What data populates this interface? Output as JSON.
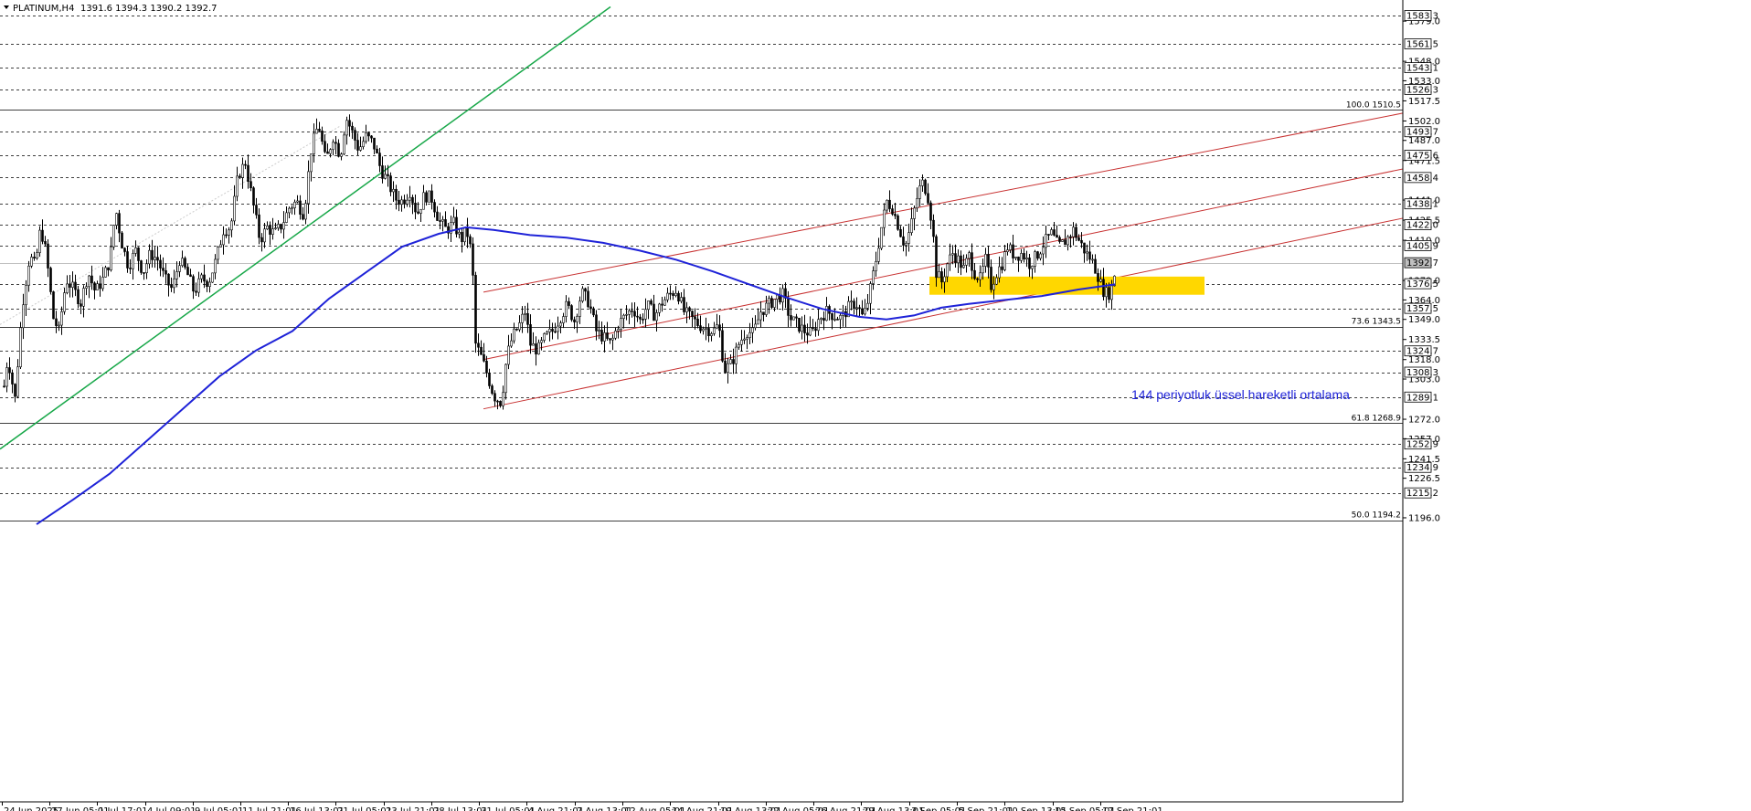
{
  "header": {
    "symbol": "PLATINUM,H4",
    "ohlc": "1391.6 1394.3 1390.2 1392.7"
  },
  "chart_data": {
    "type": "candlestick",
    "ylim": [
      1189.0,
      1592.0
    ],
    "grid": false,
    "price_ticks": [
      "1579.0",
      "1548.0",
      "1533.0",
      "1517.5",
      "1502.0",
      "1487.0",
      "1471.5",
      "1441.0",
      "1425.5",
      "1410.0",
      "1379.0",
      "1364.0",
      "1349.0",
      "1333.5",
      "1318.0",
      "1303.0",
      "1272.0",
      "1257.0",
      "1241.5",
      "1226.5",
      "1196.0"
    ],
    "level_labels": [
      "1583.3",
      "1561.5",
      "1543.1",
      "1526.3",
      "1493.7",
      "1475.6",
      "1458.4",
      "1438.1",
      "1422.0",
      "1405.9",
      "1376.5",
      "1357.5",
      "1324.7",
      "1308.3",
      "1289.1",
      "1252.9",
      "1234.9",
      "1215.2"
    ],
    "current_price": "1392.7",
    "x_labels": [
      "24 Jun 2025",
      "27 Jun 05:01",
      "1 Jul 17:01",
      "4 Jul 09:01",
      "9 Jul 05:01",
      "11 Jul 21:01",
      "16 Jul 13:01",
      "21 Jul 05:01",
      "23 Jul 21:01",
      "28 Jul 13:01",
      "31 Jul 05:01",
      "4 Aug 21:01",
      "7 Aug 13:01",
      "12 Aug 05:01",
      "14 Aug 21:01",
      "19 Aug 13:01",
      "22 Aug 05:01",
      "26 Aug 21:01",
      "29 Aug 13:01",
      "3 Sep 05:01",
      "5 Sep 21:01",
      "10 Sep 13:01",
      "15 Sep 05:01",
      "17 Sep 21:01"
    ],
    "fib_labels": [
      {
        "text": "100.0 1510.5",
        "value": 1510.5
      },
      {
        "text": "73.6 1343.5",
        "value": 1343.5
      },
      {
        "text": "61.8 1268.9",
        "value": 1268.9
      },
      {
        "text": "50.0 1194.2",
        "value": 1194.2
      }
    ],
    "annotation": "144 periyotluk üssel hareketli ortalama",
    "colors": {
      "ema": "#1f23d8",
      "channel": "#c83232",
      "trendline": "#19a84a",
      "zone": "#ffd700",
      "candle": "#000000",
      "annotation": "#1f23d8"
    },
    "support_zone": [
      1368.0,
      1382.0
    ],
    "price_path": [
      [
        0,
        1275
      ],
      [
        8,
        1320
      ],
      [
        16,
        1288
      ],
      [
        24,
        1360
      ],
      [
        32,
        1398
      ],
      [
        38,
        1390
      ],
      [
        44,
        1420
      ],
      [
        50,
        1400
      ],
      [
        58,
        1350
      ],
      [
        64,
        1340
      ],
      [
        72,
        1380
      ],
      [
        80,
        1372
      ],
      [
        88,
        1362
      ],
      [
        96,
        1385
      ],
      [
        104,
        1370
      ],
      [
        112,
        1380
      ],
      [
        120,
        1395
      ],
      [
        126,
        1435
      ],
      [
        132,
        1410
      ],
      [
        140,
        1390
      ],
      [
        148,
        1402
      ],
      [
        156,
        1385
      ],
      [
        164,
        1400
      ],
      [
        172,
        1395
      ],
      [
        180,
        1380
      ],
      [
        188,
        1372
      ],
      [
        196,
        1395
      ],
      [
        204,
        1385
      ],
      [
        212,
        1370
      ],
      [
        220,
        1380
      ],
      [
        228,
        1378
      ],
      [
        236,
        1395
      ],
      [
        244,
        1418
      ],
      [
        252,
        1420
      ],
      [
        260,
        1460
      ],
      [
        268,
        1470
      ],
      [
        276,
        1440
      ],
      [
        284,
        1410
      ],
      [
        292,
        1420
      ],
      [
        300,
        1415
      ],
      [
        308,
        1422
      ],
      [
        316,
        1435
      ],
      [
        324,
        1440
      ],
      [
        332,
        1430
      ],
      [
        340,
        1480
      ],
      [
        348,
        1500
      ],
      [
        356,
        1470
      ],
      [
        364,
        1490
      ],
      [
        372,
        1475
      ],
      [
        378,
        1505
      ],
      [
        384,
        1495
      ],
      [
        392,
        1480
      ],
      [
        400,
        1490
      ],
      [
        408,
        1485
      ],
      [
        416,
        1465
      ],
      [
        424,
        1455
      ],
      [
        432,
        1442
      ],
      [
        440,
        1440
      ],
      [
        448,
        1448
      ],
      [
        456,
        1430
      ],
      [
        464,
        1445
      ],
      [
        472,
        1442
      ],
      [
        480,
        1425
      ],
      [
        488,
        1418
      ],
      [
        496,
        1423
      ],
      [
        504,
        1410
      ],
      [
        510,
        1418
      ],
      [
        516,
        1398
      ],
      [
        520,
        1330
      ],
      [
        526,
        1320
      ],
      [
        532,
        1308
      ],
      [
        540,
        1290
      ],
      [
        548,
        1285
      ],
      [
        554,
        1320
      ],
      [
        560,
        1335
      ],
      [
        568,
        1345
      ],
      [
        574,
        1355
      ],
      [
        580,
        1330
      ],
      [
        588,
        1325
      ],
      [
        596,
        1335
      ],
      [
        604,
        1340
      ],
      [
        612,
        1350
      ],
      [
        620,
        1360
      ],
      [
        628,
        1348
      ],
      [
        636,
        1370
      ],
      [
        644,
        1362
      ],
      [
        652,
        1340
      ],
      [
        660,
        1335
      ],
      [
        668,
        1330
      ],
      [
        676,
        1345
      ],
      [
        684,
        1352
      ],
      [
        692,
        1358
      ],
      [
        700,
        1348
      ],
      [
        708,
        1360
      ],
      [
        716,
        1352
      ],
      [
        724,
        1362
      ],
      [
        732,
        1368
      ],
      [
        740,
        1372
      ],
      [
        748,
        1355
      ],
      [
        756,
        1350
      ],
      [
        764,
        1345
      ],
      [
        772,
        1342
      ],
      [
        780,
        1340
      ],
      [
        786,
        1345
      ],
      [
        792,
        1310
      ],
      [
        800,
        1315
      ],
      [
        808,
        1330
      ],
      [
        816,
        1340
      ],
      [
        824,
        1338
      ],
      [
        832,
        1355
      ],
      [
        840,
        1360
      ],
      [
        848,
        1365
      ],
      [
        856,
        1368
      ],
      [
        864,
        1350
      ],
      [
        872,
        1345
      ],
      [
        880,
        1340
      ],
      [
        888,
        1338
      ],
      [
        896,
        1350
      ],
      [
        904,
        1355
      ],
      [
        912,
        1352
      ],
      [
        920,
        1350
      ],
      [
        928,
        1358
      ],
      [
        936,
        1362
      ],
      [
        944,
        1350
      ],
      [
        950,
        1365
      ],
      [
        958,
        1395
      ],
      [
        964,
        1420
      ],
      [
        970,
        1440
      ],
      [
        976,
        1435
      ],
      [
        984,
        1418
      ],
      [
        990,
        1405
      ],
      [
        996,
        1420
      ],
      [
        1002,
        1440
      ],
      [
        1008,
        1455
      ],
      [
        1014,
        1448
      ],
      [
        1020,
        1420
      ],
      [
        1024,
        1385
      ],
      [
        1030,
        1378
      ],
      [
        1036,
        1392
      ],
      [
        1042,
        1400
      ],
      [
        1048,
        1395
      ],
      [
        1054,
        1388
      ],
      [
        1060,
        1398
      ],
      [
        1066,
        1385
      ],
      [
        1072,
        1380
      ],
      [
        1078,
        1395
      ],
      [
        1084,
        1375
      ],
      [
        1090,
        1385
      ],
      [
        1096,
        1392
      ],
      [
        1102,
        1405
      ],
      [
        1110,
        1398
      ],
      [
        1118,
        1400
      ],
      [
        1126,
        1392
      ],
      [
        1134,
        1398
      ],
      [
        1142,
        1408
      ],
      [
        1150,
        1415
      ],
      [
        1158,
        1405
      ],
      [
        1166,
        1410
      ],
      [
        1174,
        1418
      ],
      [
        1180,
        1410
      ],
      [
        1188,
        1400
      ],
      [
        1194,
        1395
      ],
      [
        1200,
        1385
      ],
      [
        1206,
        1372
      ],
      [
        1212,
        1368
      ],
      [
        1218,
        1376
      ],
      [
        1220,
        1392.7
      ]
    ],
    "ema144": [
      [
        40,
        1191
      ],
      [
        80,
        1210
      ],
      [
        120,
        1230
      ],
      [
        160,
        1255
      ],
      [
        200,
        1280
      ],
      [
        240,
        1305
      ],
      [
        280,
        1325
      ],
      [
        320,
        1340
      ],
      [
        360,
        1365
      ],
      [
        400,
        1385
      ],
      [
        440,
        1405
      ],
      [
        480,
        1415
      ],
      [
        510,
        1420
      ],
      [
        540,
        1418
      ],
      [
        580,
        1414
      ],
      [
        620,
        1412
      ],
      [
        660,
        1408
      ],
      [
        700,
        1402
      ],
      [
        740,
        1395
      ],
      [
        780,
        1386
      ],
      [
        820,
        1376
      ],
      [
        860,
        1366
      ],
      [
        900,
        1357
      ],
      [
        940,
        1351
      ],
      [
        970,
        1349
      ],
      [
        1000,
        1352
      ],
      [
        1030,
        1358
      ],
      [
        1060,
        1361
      ],
      [
        1100,
        1364
      ],
      [
        1140,
        1367
      ],
      [
        1180,
        1372
      ],
      [
        1220,
        1376
      ]
    ]
  }
}
